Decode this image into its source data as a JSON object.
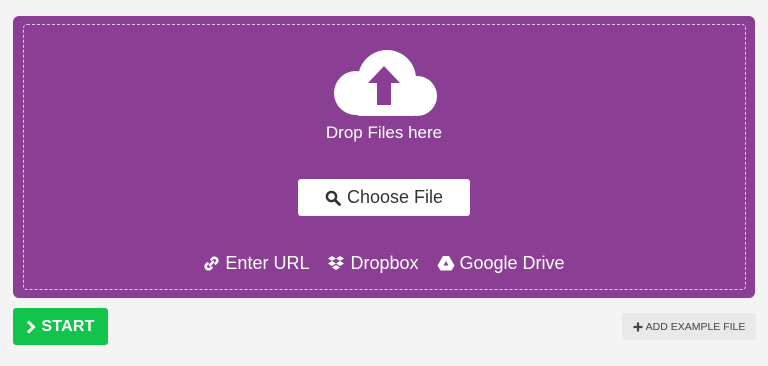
{
  "colors": {
    "dropzone_bg": "#8a3f94",
    "start_button": "#12c44b",
    "page_bg": "#f4f4f4"
  },
  "dropzone": {
    "icon": "cloud-upload-icon",
    "label": "Drop Files here",
    "choose_button": {
      "icon": "search-icon",
      "label": "Choose File"
    },
    "sources": [
      {
        "icon": "link-icon",
        "label": "Enter URL"
      },
      {
        "icon": "dropbox-icon",
        "label": "Dropbox"
      },
      {
        "icon": "google-drive-icon",
        "label": "Google Drive"
      }
    ]
  },
  "actions": {
    "start": {
      "icon": "chevron-right-icon",
      "label": "START"
    },
    "add_example": {
      "icon": "plus-icon",
      "label": "ADD EXAMPLE FILE"
    }
  }
}
